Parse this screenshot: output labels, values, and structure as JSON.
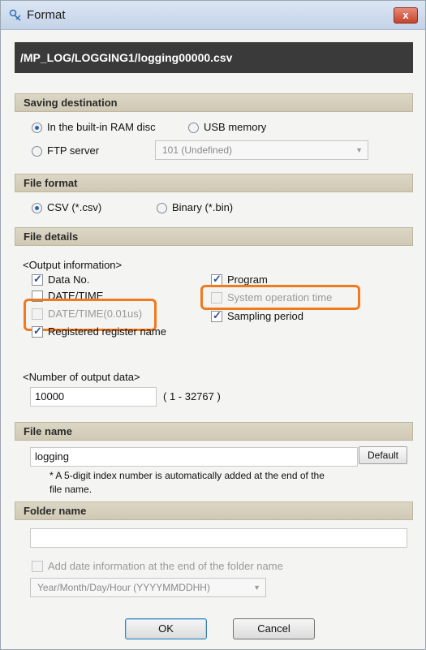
{
  "window": {
    "title": "Format",
    "close_symbol": "x",
    "path": "/MP_LOG/LOGGING1/logging00000.csv"
  },
  "saving_destination": {
    "header": "Saving destination",
    "options": [
      {
        "label": "In the built-in RAM disc",
        "selected": true
      },
      {
        "label": "USB memory",
        "selected": false
      },
      {
        "label": "FTP server",
        "selected": false
      }
    ],
    "ftp_select_value": "101 (Undefined)"
  },
  "file_format": {
    "header": "File format",
    "options": [
      {
        "label": "CSV (*.csv)",
        "selected": true
      },
      {
        "label": "Binary (*.bin)",
        "selected": false
      }
    ]
  },
  "file_details": {
    "header": "File details",
    "output_info_label": "<Output information>",
    "checkboxes": [
      {
        "label": "Data No.",
        "checked": true
      },
      {
        "label": "DATE/TIME",
        "checked": false
      },
      {
        "label": "DATE/TIME(0.01us)",
        "checked": false
      },
      {
        "label": "Registered register name",
        "checked": true
      },
      {
        "label": "Program",
        "checked": true
      },
      {
        "label": "System operation time",
        "checked": false
      },
      {
        "label": "Sampling period",
        "checked": true
      }
    ],
    "output_count_label": "<Number of output data>",
    "output_count_value": "10000",
    "output_count_range": "( 1 - 32767 )"
  },
  "file_name": {
    "header": "File name",
    "value": "logging",
    "default_button": "Default",
    "note_line1": "* A 5-digit index number is automatically added at the end of the",
    "note_line2": "file name."
  },
  "folder_name": {
    "header": "Folder name",
    "value": "",
    "add_date_label": "Add date information at the end of the folder name",
    "date_format_value": "Year/Month/Day/Hour (YYYYMMDDHH)"
  },
  "buttons": {
    "ok": "OK",
    "cancel": "Cancel"
  },
  "colors": {
    "highlight": "#f07a1e",
    "section_header": "#d6d1bd",
    "path_bar": "#3a3a3a"
  }
}
